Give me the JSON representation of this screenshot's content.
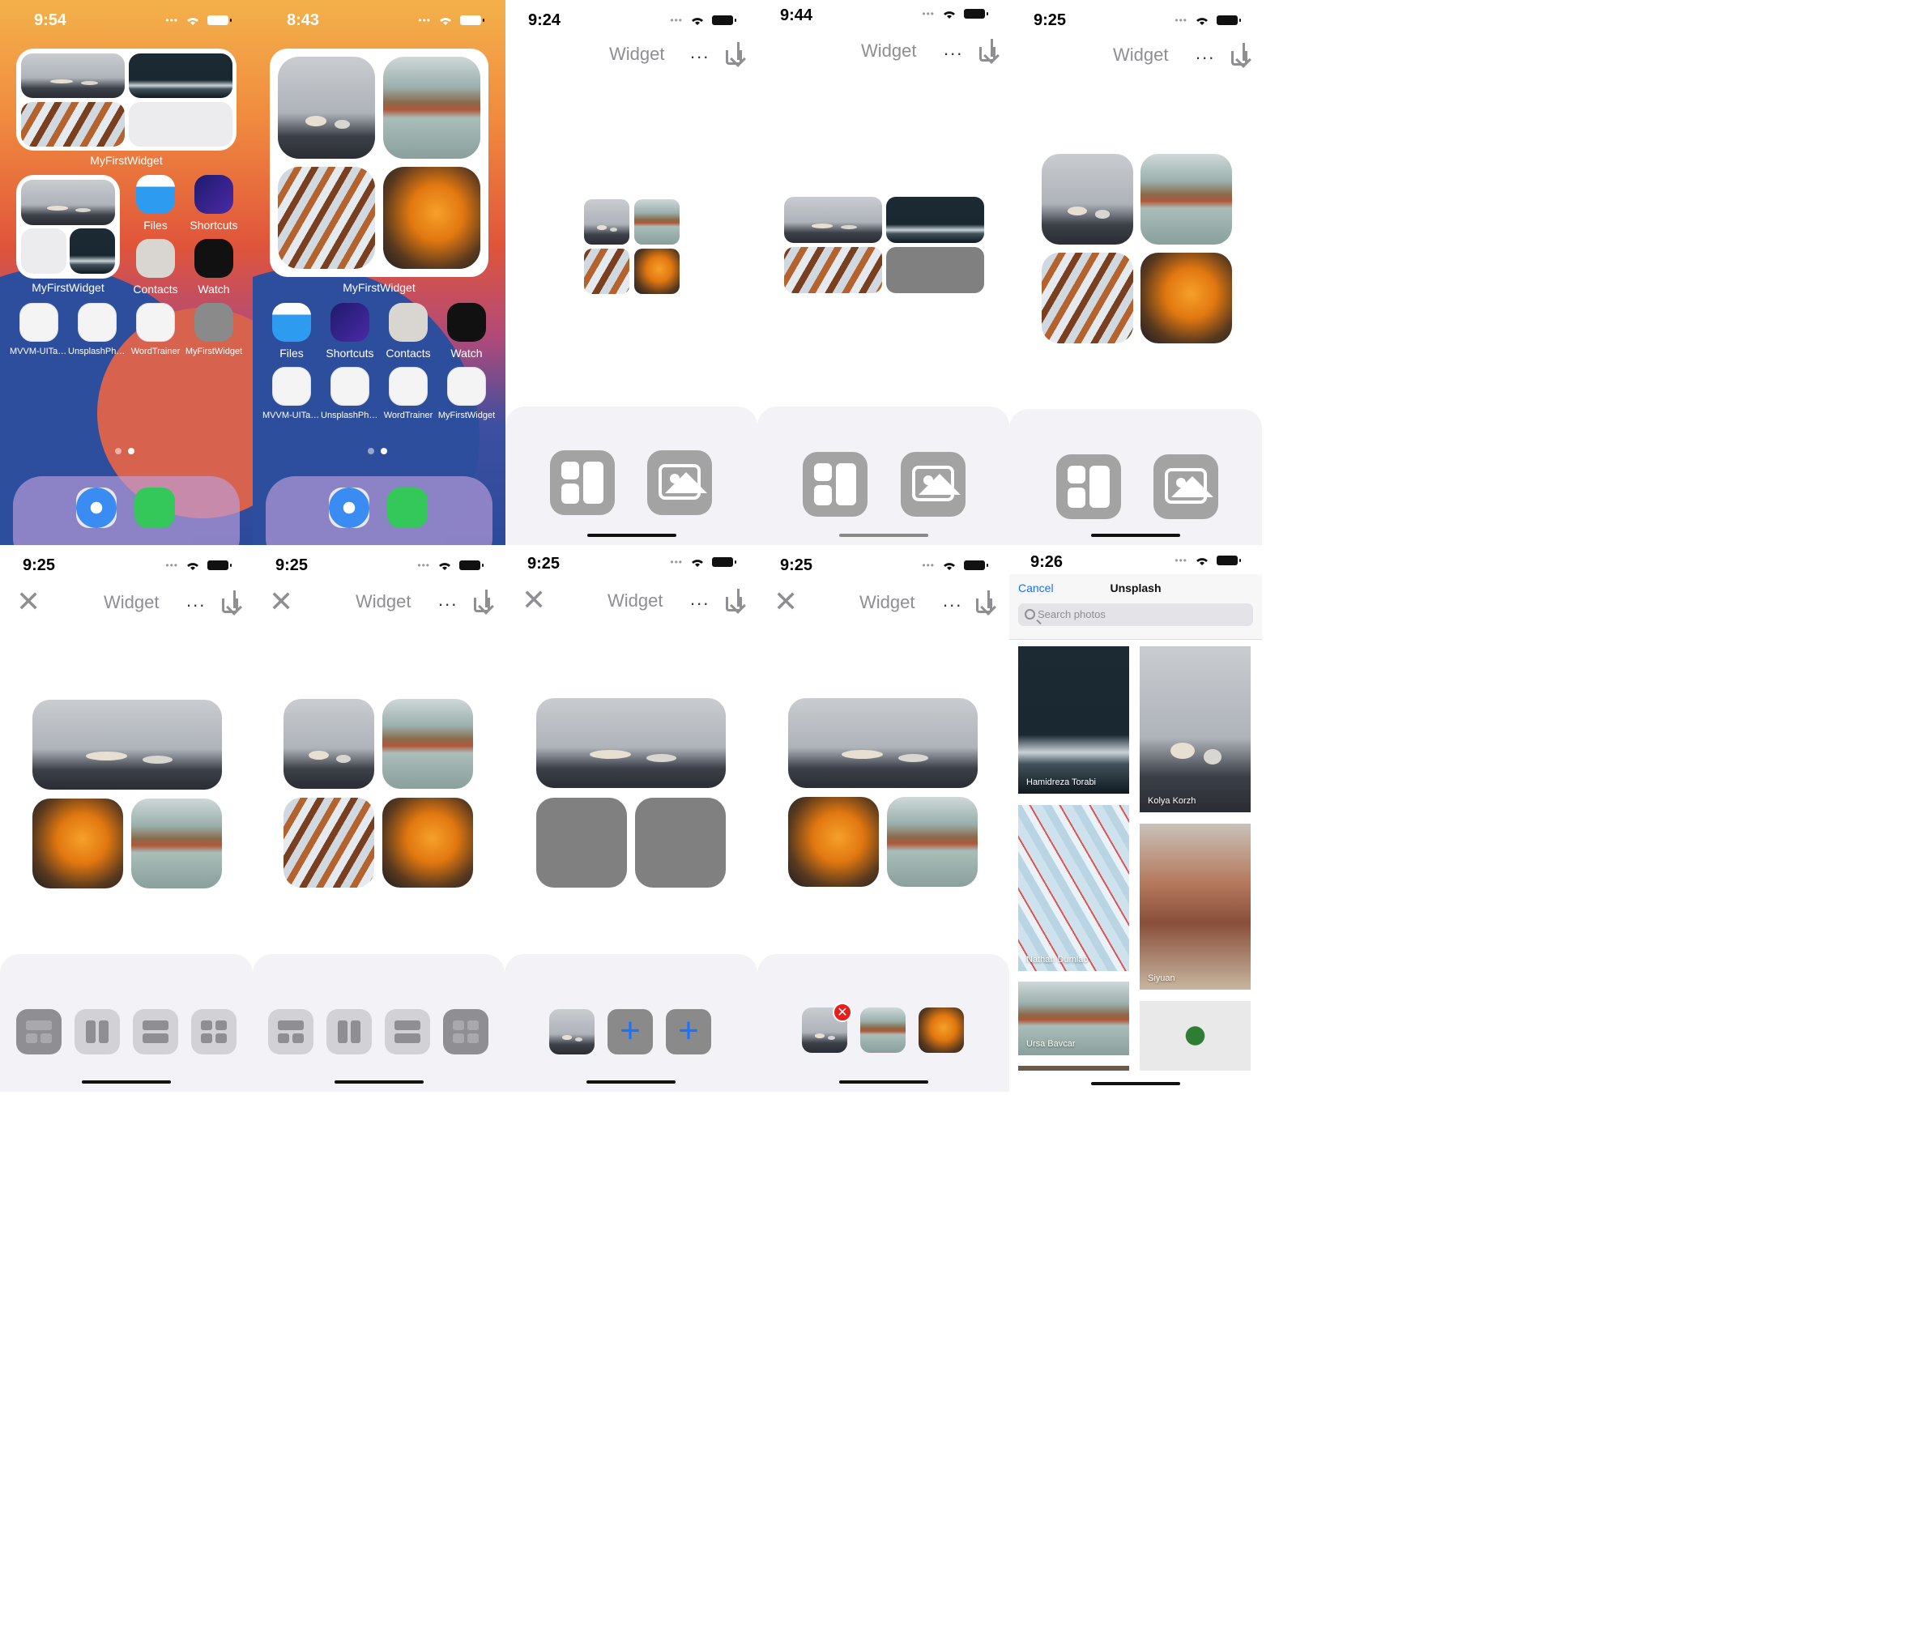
{
  "panels": {
    "p1": {
      "time": "9:54",
      "widget_label_a": "MyFirstWidget",
      "widget_label_b": "MyFirstWidget",
      "apps_row1": [
        "Files",
        "Shortcuts"
      ],
      "apps_row2": [
        "Contacts",
        "Watch"
      ],
      "apps_row3": [
        "MVVM-UITable...",
        "UnsplashPhot...",
        "WordTrainer",
        "MyFirstWidget"
      ]
    },
    "p2": {
      "time": "8:43",
      "widget_label": "MyFirstWidget",
      "apps_row1": [
        "Files",
        "Shortcuts",
        "Contacts",
        "Watch"
      ],
      "apps_row2": [
        "MVVM-UITable...",
        "UnsplashPhot...",
        "WordTrainer",
        "MyFirstWidget"
      ]
    },
    "p3": {
      "time": "9:24",
      "title": "Widget",
      "more": "..."
    },
    "p4": {
      "time": "9:44",
      "title": "Widget",
      "more": "..."
    },
    "p5": {
      "time": "9:25",
      "title": "Widget",
      "more": "..."
    },
    "p6": {
      "time": "9:25",
      "title": "Widget",
      "more": "..."
    },
    "p7": {
      "time": "9:25",
      "title": "Widget",
      "more": "..."
    },
    "p8": {
      "time": "9:25",
      "title": "Widget",
      "more": "..."
    },
    "p9": {
      "time": "9:25",
      "title": "Widget",
      "more": "..."
    },
    "p10": {
      "time": "9:26",
      "cancel": "Cancel",
      "title": "Unsplash",
      "search_placeholder": "Search photos",
      "photos_left": [
        "Hamidreza Torabi",
        "Nathan Dumlao",
        "Ursa Bavcar"
      ],
      "photos_right": [
        "Kolya Korzh",
        "Siyuan"
      ]
    }
  },
  "icons": {
    "close": "close-icon",
    "download": "download-icon",
    "layout": "layout-icon",
    "photo": "photo-icon",
    "plus": "plus-icon",
    "remove": "remove-badge-icon",
    "search": "search-icon"
  },
  "colors": {
    "accent": "#1a73e8",
    "sheet": "#f2f2f7",
    "button_gray": "#a3a3a3",
    "remove_red": "#e5201c"
  }
}
